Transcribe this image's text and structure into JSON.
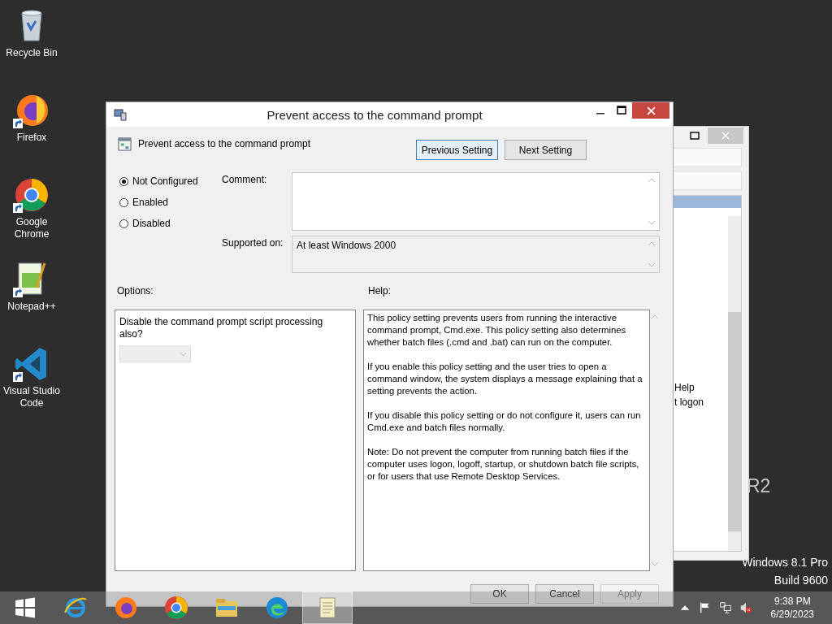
{
  "desktop_icons": [
    {
      "label": "Recycle Bin",
      "kind": "recycle",
      "shortcut": false
    },
    {
      "label": "Firefox",
      "kind": "firefox",
      "shortcut": true
    },
    {
      "label": "Google Chrome",
      "kind": "chrome",
      "shortcut": true
    },
    {
      "label": "Notepad++",
      "kind": "notepadpp",
      "shortcut": true
    },
    {
      "label": "Visual Studio Code",
      "kind": "vscode",
      "shortcut": true
    }
  ],
  "desktop_text": {
    "edition_fragment": "R2",
    "os": "Windows 8.1 Pro",
    "build": "Build 9600"
  },
  "background_window": {
    "texts": [
      "Help",
      "t logon"
    ]
  },
  "dialog": {
    "title": "Prevent access to the command prompt",
    "policy_name": "Prevent access to the command prompt",
    "nav_buttons": [
      {
        "label": "Previous Setting",
        "focused": true
      },
      {
        "label": "Next Setting",
        "focused": false
      }
    ],
    "state_options": [
      {
        "label": "Not Configured",
        "selected": true
      },
      {
        "label": "Enabled",
        "selected": false
      },
      {
        "label": "Disabled",
        "selected": false
      }
    ],
    "comment_label": "Comment:",
    "supported_label": "Supported on:",
    "supported_value": "At least Windows 2000",
    "options_label": "Options:",
    "help_label": "Help:",
    "option_text": "Disable the command prompt script processing also?",
    "help_paragraphs": [
      "This policy setting prevents users from running the interactive command prompt, Cmd.exe.  This policy setting also determines whether batch files (.cmd and .bat) can run on the computer.",
      "If you enable this policy setting and the user tries to open a command window, the system displays a message explaining that a setting prevents the action.",
      "If you disable this policy setting or do not configure it, users can run Cmd.exe and batch files normally.",
      "Note: Do not prevent the computer from running batch files if the computer uses logon, logoff, startup, or shutdown batch file scripts, or for users that use Remote Desktop Services."
    ],
    "buttons": [
      {
        "label": "OK",
        "disabled": false
      },
      {
        "label": "Cancel",
        "disabled": false
      },
      {
        "label": "Apply",
        "disabled": true
      }
    ]
  },
  "taskbar": {
    "apps": [
      {
        "kind": "start",
        "selected": false
      },
      {
        "kind": "ie",
        "selected": false
      },
      {
        "kind": "firefox",
        "selected": false
      },
      {
        "kind": "chrome",
        "selected": false
      },
      {
        "kind": "explorer",
        "selected": false
      },
      {
        "kind": "edge",
        "selected": false
      },
      {
        "kind": "notepad",
        "selected": true
      }
    ],
    "time": "9:38 PM",
    "date": "6/29/2023",
    "volume_muted": true
  }
}
